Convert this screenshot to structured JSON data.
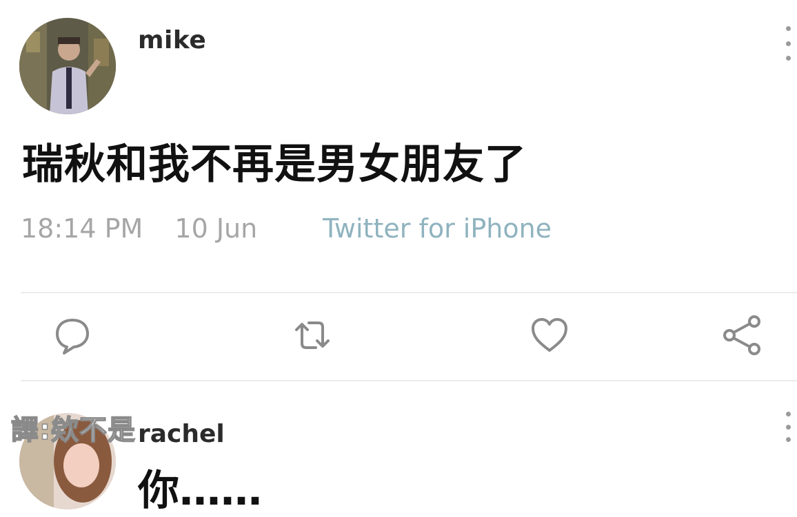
{
  "post": {
    "username": "mike",
    "text": "瑞秋和我不再是男女朋友了",
    "time": "18:14 PM",
    "date": "10 Jun",
    "source": "Twitter for iPhone",
    "source_color": "#8fb3bf",
    "actions": [
      {
        "name": "reply-icon"
      },
      {
        "name": "retweet-icon"
      },
      {
        "name": "like-icon"
      },
      {
        "name": "share-icon"
      }
    ]
  },
  "reply": {
    "username": "rachel",
    "text": "你……"
  },
  "watermark": {
    "text": "譯:欸不是"
  }
}
